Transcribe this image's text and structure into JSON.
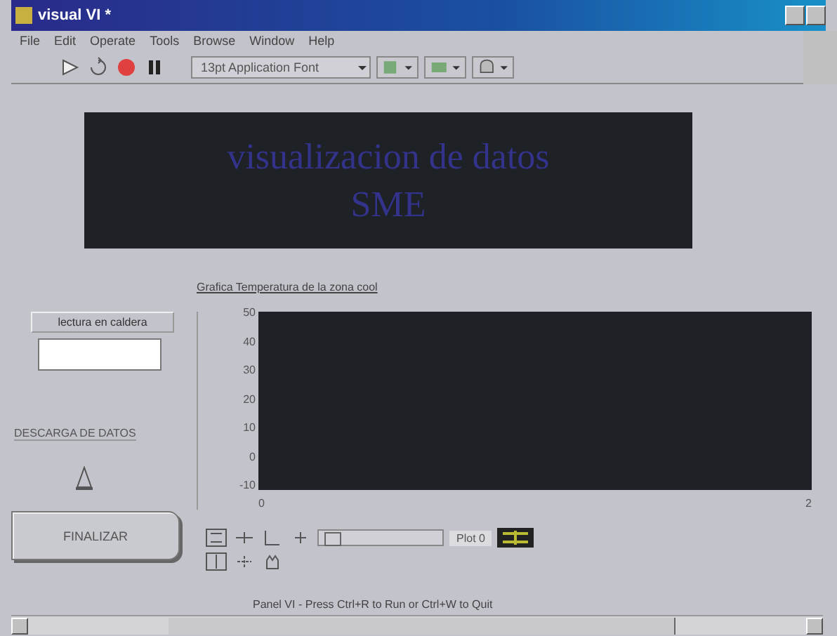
{
  "window": {
    "title": "visual VI *"
  },
  "menu": [
    "File",
    "Edit",
    "Operate",
    "Tools",
    "Browse",
    "Window",
    "Help"
  ],
  "toolbar": {
    "font": "13pt Application Font"
  },
  "banner": {
    "lines": [
      "visualizacion de datos",
      "SME"
    ]
  },
  "reading": {
    "label": "lectura en caldera"
  },
  "download": {
    "label": "DESCARGA DE DATOS"
  },
  "finish_button": {
    "label": "FINALIZAR"
  },
  "chart": {
    "title": "Grafica Temperatura de la zona cool",
    "y_ticks": [
      "50",
      "40",
      "30",
      "20",
      "10",
      "0",
      "-10"
    ],
    "x_ticks": [
      "0",
      "2"
    ],
    "legend": "Plot 0",
    "slider": {
      "level": 0.05
    }
  },
  "status_bar": "Panel VI - Press Ctrl+R to Run or Ctrl+W to Quit"
}
